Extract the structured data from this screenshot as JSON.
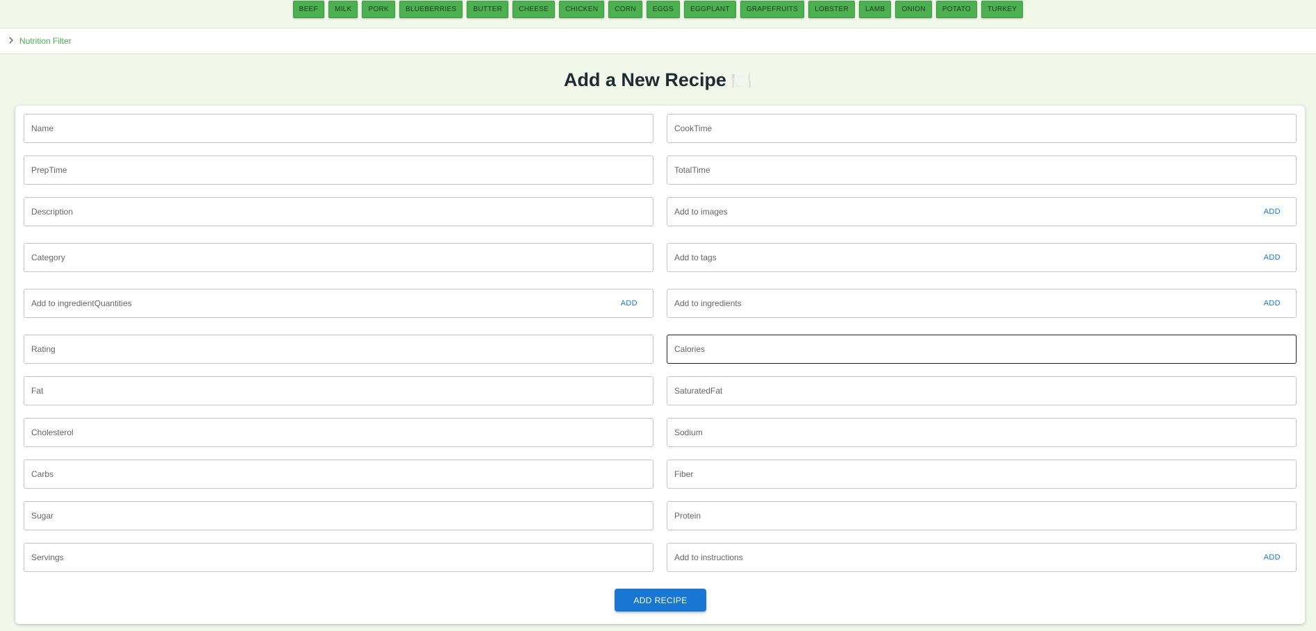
{
  "ingredients": [
    "BEEF",
    "MILK",
    "PORK",
    "BLUEBERRIES",
    "BUTTER",
    "CHEESE",
    "CHICKEN",
    "CORN",
    "EGGS",
    "EGGPLANT",
    "GRAPEFRUITS",
    "LOBSTER",
    "LAMB",
    "ONION",
    "POTATO",
    "TURKEY"
  ],
  "filter": {
    "label": "Nutrition Filter"
  },
  "title": {
    "text": "Add a New Recipe",
    "emoji": "🍽️"
  },
  "form": {
    "name": "Name",
    "cook_time": "CookTime",
    "prep_time": "PrepTime",
    "total_time": "TotalTime",
    "description": "Description",
    "images": "Add to images",
    "category": "Category",
    "tags": "Add to tags",
    "ingredient_quantities": "Add to ingredientQuantities",
    "ingredients_list": "Add to ingredients",
    "rating": "Rating",
    "calories": "Calories",
    "fat": "Fat",
    "saturated_fat": "SaturatedFat",
    "cholesterol": "Cholesterol",
    "sodium": "Sodium",
    "carbs": "Carbs",
    "fiber": "Fiber",
    "sugar": "Sugar",
    "protein": "Protein",
    "servings": "Servings",
    "instructions": "Add to instructions",
    "add_label": "ADD",
    "submit_label": "ADD RECIPE"
  },
  "colors": {
    "accent_green": "#4caf50",
    "primary_blue": "#1976d2",
    "background": "#f1f7e9"
  }
}
